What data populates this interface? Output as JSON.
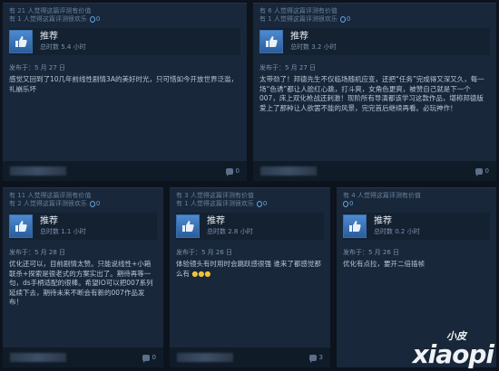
{
  "reviews": [
    {
      "helpful": "有 21 人觉得这篇评测有价值",
      "funny": "有 1 人觉得这篇评测很欢乐",
      "award_count": "0",
      "verdict": "推荐",
      "hours": "总时数 5.4 小时",
      "posted": "发布于：5 月 27 日",
      "text": "感觉又回到了10几年前线性剧情3A的美好时光，只可惜如今开放世界泛滥，礼崩乐坏",
      "comments": "0"
    },
    {
      "helpful": "有 6 人觉得这篇评测有价值",
      "funny": "有 1 人觉得这篇评测很欢乐",
      "award_count": "0",
      "verdict": "推荐",
      "hours": "总时数 3.2 小时",
      "posted": "发布于：5 月 27 日",
      "text": "太带劲了！邦德先生不仅临场随机应变，还把“任务”完成得又深又久，每一场“色诱”都让人脸红心跳，打斗爽，女角色更爽，被赞自己就是下一个007，床上双化枪战还刺激！现阶所有导演都该学习这款作品，堪称邦德版爱上了那种让人欲罢不能的风景，完完首后继续再看。必玩神作！",
      "comments": "0"
    },
    {
      "helpful": "有 11 人觉得这篇评测有价值",
      "funny": "有 2 人觉得这篇评测很欢乐",
      "award_count": "0",
      "verdict": "推荐",
      "hours": "总时数 1.1 小时",
      "posted": "发布于：5 月 28 日",
      "text": "优化还可以，目前剧情太赞。只能说线性+小箱联杀+探索是很老式的方案实出了。期待再等一句，ds手柄适配的很棒。希望IO可以把007系列延续下去，期待未来不断会有新的007作品发布！",
      "comments": "0"
    },
    {
      "helpful": "有 3 人觉得这篇评测有价值",
      "funny": "有 1 人觉得这篇评测很欢乐",
      "award_count": "0",
      "verdict": "推荐",
      "hours": "总时数 2.8 小时",
      "posted": "发布于：5 月 26 日",
      "text": "体验镜头有时用时会跳跃感很强 谁来了都感觉那么有",
      "comments": "3"
    },
    {
      "helpful": "有 4 人觉得这篇评测有价值",
      "funny": "",
      "award_count": "0",
      "verdict": "推荐",
      "hours": "总时数 0.2 小时",
      "posted": "发布于：5 月 26 日",
      "text": "优化有点拉，要开二倍插帧",
      "comments": "0"
    }
  ],
  "watermark": {
    "cn": "小皮",
    "en": "xiaopi"
  },
  "colors": {
    "page_bg": "#0d131c",
    "card_bg": "#18273a",
    "thumb_blue": "#4d8ad2",
    "award_blue": "#67a3dc"
  },
  "icons": {
    "verdict": "thumbs-up-icon",
    "award": "award-icon",
    "comment": "comment-bubble-icon"
  }
}
